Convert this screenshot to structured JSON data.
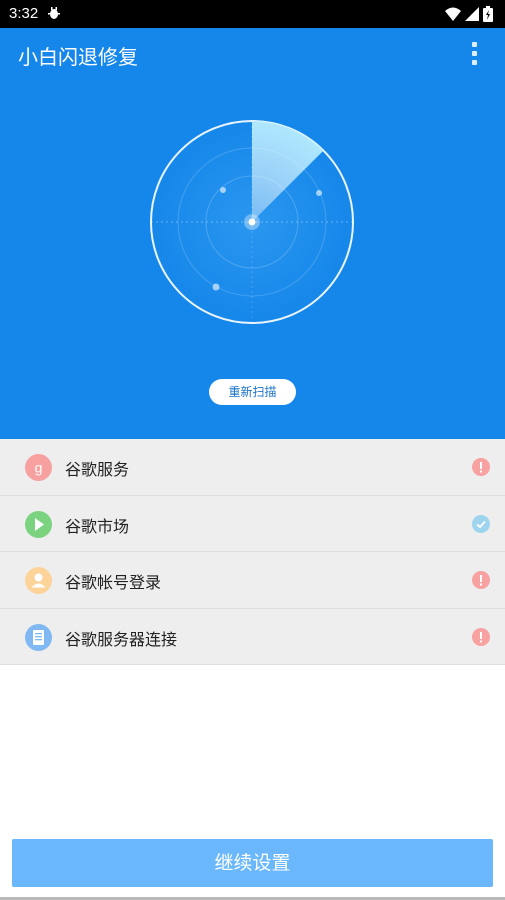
{
  "status_bar": {
    "time": "3:32",
    "notification_icon": "bug-icon",
    "icons": [
      "wifi-icon",
      "signal-icon",
      "battery-charging-icon"
    ]
  },
  "app_bar": {
    "title": "小白闪退修复",
    "menu_icon": "more-vert-icon"
  },
  "colors": {
    "header_bg": "#1587ea",
    "list_bg": "#eeeeee",
    "button_bg": "#6ab7fb",
    "status_error": "#f7a1a1",
    "status_ok": "#9fd4ee"
  },
  "scan": {
    "rescan_label": "重新扫描"
  },
  "checks": [
    {
      "label": "谷歌服务",
      "icon": "google-g-icon",
      "icon_color": "#f7a0a0",
      "status": "error"
    },
    {
      "label": "谷歌市场",
      "icon": "play-store-icon",
      "icon_color": "#7bd27f",
      "status": "ok"
    },
    {
      "label": "谷歌帐号登录",
      "icon": "account-icon",
      "icon_color": "#fcd49a",
      "status": "error"
    },
    {
      "label": "谷歌服务器连接",
      "icon": "document-icon",
      "icon_color": "#7fb8f2",
      "status": "error"
    }
  ],
  "footer": {
    "continue_label": "继续设置"
  }
}
